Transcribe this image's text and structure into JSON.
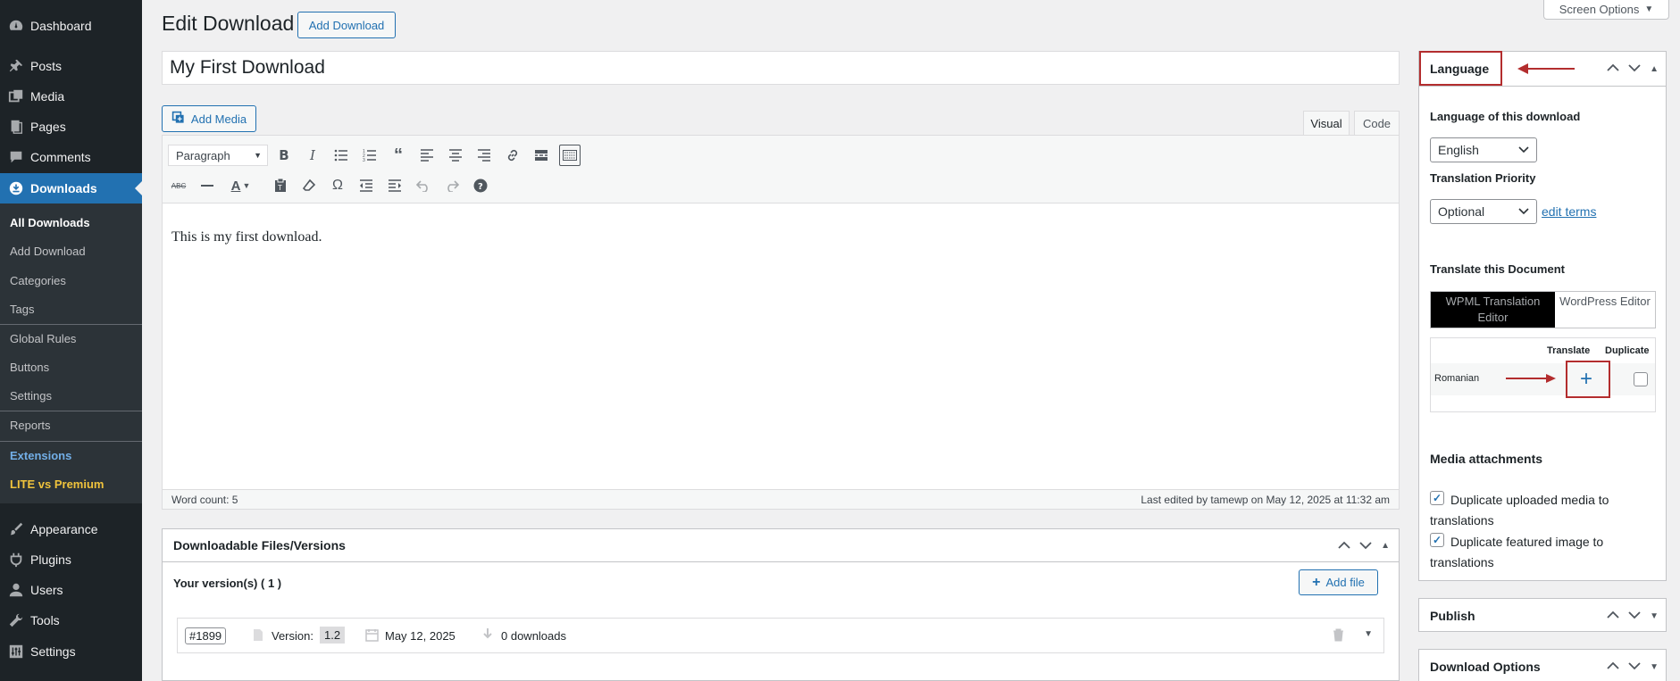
{
  "sidebar": {
    "dashboard": "Dashboard",
    "posts": "Posts",
    "media": "Media",
    "pages": "Pages",
    "comments": "Comments",
    "downloads": "Downloads",
    "submenu": {
      "all_downloads": "All Downloads",
      "add_download": "Add Download",
      "categories": "Categories",
      "tags": "Tags",
      "global_rules": "Global Rules",
      "buttons": "Buttons",
      "settings": "Settings",
      "reports": "Reports",
      "extensions": "Extensions",
      "lite_vs_premium": "LITE vs Premium"
    },
    "appearance": "Appearance",
    "plugins": "Plugins",
    "users": "Users",
    "tools": "Tools",
    "settings": "Settings"
  },
  "header": {
    "title": "Edit Download",
    "add_button": "Add Download",
    "screen_options": "Screen Options"
  },
  "post": {
    "title": "My First Download",
    "add_media": "Add Media",
    "tab_visual": "Visual",
    "tab_code": "Code",
    "format": "Paragraph",
    "content": "This is my first download.",
    "word_count": "Word count: 5",
    "last_edited": "Last edited by tamewp on May 12, 2025 at 11:32 am"
  },
  "files": {
    "title": "Downloadable Files/Versions",
    "your_versions": "Your version(s) ( 1 )",
    "add_file": "Add file",
    "row": {
      "id": "#1899",
      "version_label": "Version:",
      "version_value": "1.2",
      "date": "May 12, 2025",
      "downloads": "0 downloads"
    }
  },
  "language_box": {
    "title": "Language",
    "language_label": "Language of this download",
    "language_value": "English",
    "priority_label": "Translation Priority",
    "priority_value": "Optional",
    "edit_terms": "edit terms",
    "translate_label": "Translate this Document",
    "wpml_editor": "WPML Translation Editor",
    "wp_editor": "WordPress Editor",
    "col_translate": "Translate",
    "col_duplicate": "Duplicate",
    "lang_row": "Romanian",
    "media_title": "Media attachments",
    "dup_media": "Duplicate uploaded media to translations",
    "dup_featured": "Duplicate featured image to translations"
  },
  "publish_box": {
    "title": "Publish"
  },
  "download_options_box": {
    "title": "Download Options"
  },
  "colors": {
    "accent": "#2271b1",
    "sidebar": "#1d2327",
    "annotation": "#b32d2e"
  }
}
